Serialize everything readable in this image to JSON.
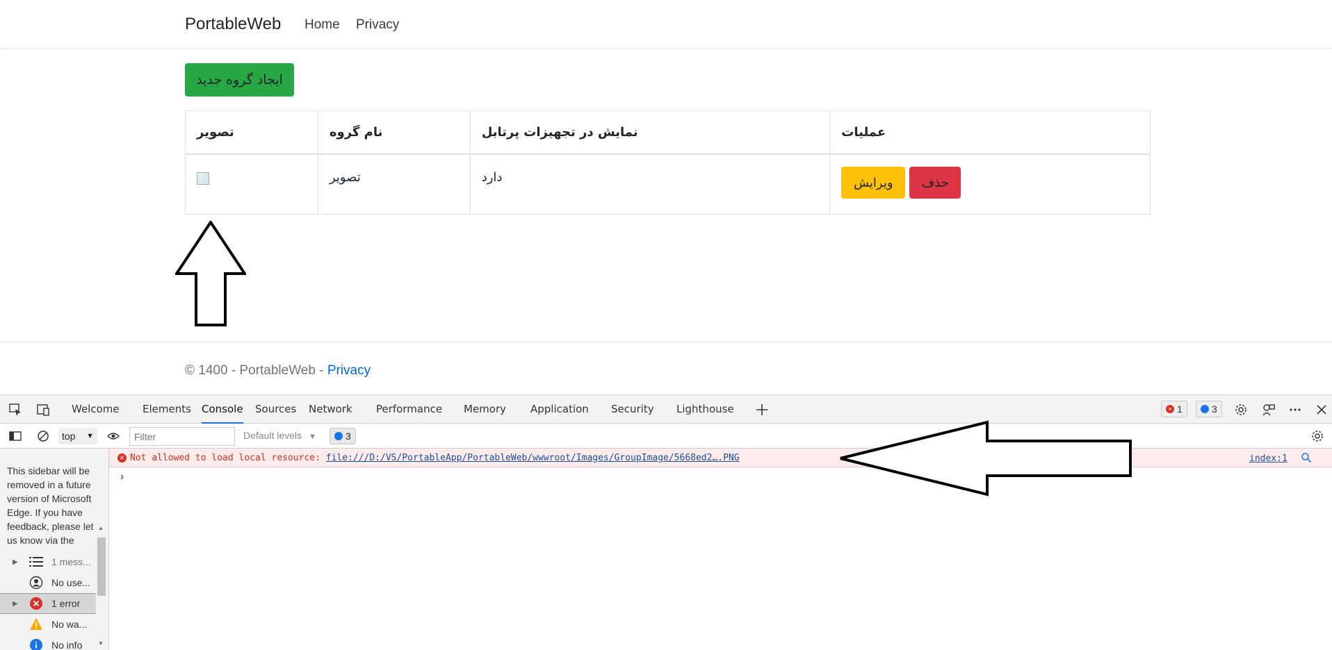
{
  "navbar": {
    "brand": "PortableWeb",
    "links": [
      "Home",
      "Privacy"
    ]
  },
  "main": {
    "create_button": "ایجاد گروه جدید",
    "table": {
      "headers": [
        "تصویر",
        "نام گروه",
        "نمایش در تجهیزات پرتابل",
        "عملیات"
      ],
      "rows": [
        {
          "image_alt": "",
          "name": "تصویر",
          "show_on_portable": "دارد",
          "edit_label": "ویرایش",
          "delete_label": "حذف"
        }
      ]
    }
  },
  "footer": {
    "copyright": "© 1400 - PortableWeb - ",
    "privacy_link": "Privacy"
  },
  "devtools": {
    "tabs": [
      "Welcome",
      "Elements",
      "Console",
      "Sources",
      "Network",
      "Performance",
      "Memory",
      "Application",
      "Security",
      "Lighthouse"
    ],
    "active_tab": "Console",
    "error_count": "1",
    "info_count": "3",
    "context": "top",
    "filter_placeholder": "Filter",
    "levels": "Default levels",
    "message_badge": "3",
    "sidebar_note": "This sidebar will be removed in a future version of Microsoft Edge. If you have feedback, please let us know via the",
    "sidebar_items": [
      {
        "label": "1 mess...",
        "icon": "list-icon"
      },
      {
        "label": "No use...",
        "icon": "user-icon"
      },
      {
        "label": "1 error",
        "icon": "error-icon"
      },
      {
        "label": "No wa...",
        "icon": "warning-icon"
      },
      {
        "label": "No info",
        "icon": "info-icon"
      }
    ],
    "error_message_prefix": "Not allowed to load local resource: ",
    "error_url": "file:///D:/VS/PortableApp/PortableWeb/wwwroot/Images/GroupImage/5668ed2….PNG",
    "error_source": "index:1",
    "colors": {
      "error": "#d93025",
      "link": "#1a4fa0",
      "accent": "#1a73e8"
    }
  }
}
